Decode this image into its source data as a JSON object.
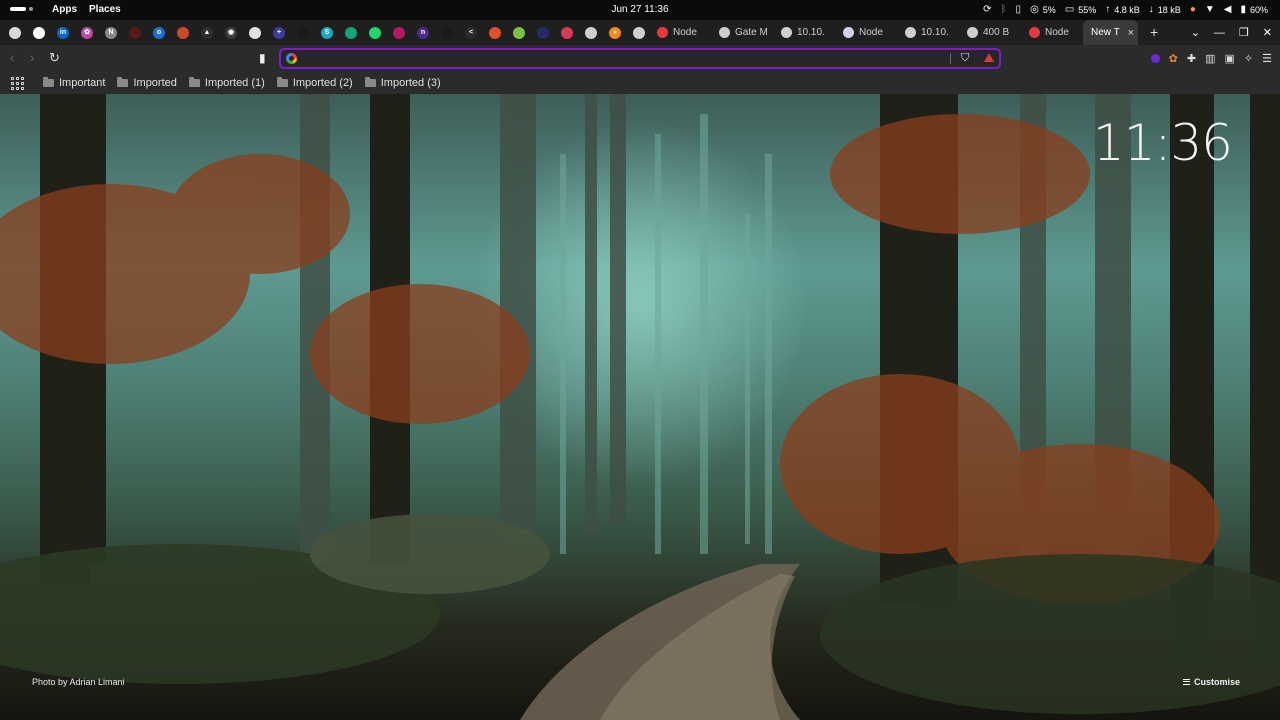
{
  "topbar": {
    "apps_label": "Apps",
    "places_label": "Places",
    "datetime": "Jun 27  11:36",
    "tray": {
      "cpu": "5%",
      "memory": "55%",
      "upload": "4.8 kB",
      "download": "18 kB",
      "battery": "60%"
    }
  },
  "pinned_tabs": [
    {
      "icon": "chrome-icon",
      "color": "#d8d8d8",
      "glyph": ""
    },
    {
      "icon": "github-icon",
      "color": "#ffffff",
      "glyph": ""
    },
    {
      "icon": "linkedin-icon",
      "color": "#0a66c2",
      "glyph": "in"
    },
    {
      "icon": "app-icon",
      "color": "#b84aa8",
      "glyph": "✿"
    },
    {
      "icon": "app-icon",
      "color": "#888888",
      "glyph": "N"
    },
    {
      "icon": "app-icon",
      "color": "#5a1818",
      "glyph": ""
    },
    {
      "icon": "outlook-icon",
      "color": "#1e6fd0",
      "glyph": "o"
    },
    {
      "icon": "app-icon",
      "color": "#c74a2a",
      "glyph": ""
    },
    {
      "icon": "app-icon",
      "color": "#2f2f2f",
      "glyph": "▲"
    },
    {
      "icon": "app-icon",
      "color": "#3c3c3c",
      "glyph": "◉"
    },
    {
      "icon": "app-icon",
      "color": "#e0e0e0",
      "glyph": ""
    },
    {
      "icon": "app-icon",
      "color": "#3b3f9a",
      "glyph": "+"
    },
    {
      "icon": "app-icon",
      "color": "#1a1a1a",
      "glyph": ""
    },
    {
      "icon": "app-icon",
      "color": "#1aa7c4",
      "glyph": "S"
    },
    {
      "icon": "app-icon",
      "color": "#12a37a",
      "glyph": ""
    },
    {
      "icon": "whatsapp-icon",
      "color": "#25d366",
      "glyph": ""
    },
    {
      "icon": "app-icon",
      "color": "#b01b63",
      "glyph": ""
    },
    {
      "icon": "app-icon",
      "color": "#4b2a8a",
      "glyph": "n"
    },
    {
      "icon": "app-icon",
      "color": "#1a1a1a",
      "glyph": ""
    },
    {
      "icon": "share-icon",
      "color": "#2c2c2c",
      "glyph": "<"
    },
    {
      "icon": "app-icon",
      "color": "#e0502a",
      "glyph": ""
    },
    {
      "icon": "app-icon",
      "color": "#7bc043",
      "glyph": ""
    },
    {
      "icon": "app-icon",
      "color": "#252a6a",
      "glyph": ""
    },
    {
      "icon": "app-icon",
      "color": "#d63a5a",
      "glyph": ""
    },
    {
      "icon": "app-icon",
      "color": "#cfcfcf",
      "glyph": ""
    },
    {
      "icon": "app-icon",
      "color": "#f08a1a",
      "glyph": "»"
    },
    {
      "icon": "app-icon",
      "color": "#cfcfcf",
      "glyph": ""
    }
  ],
  "tabs": [
    {
      "title": "Node",
      "icon": "node-red-icon",
      "icon_color": "#e33a3a"
    },
    {
      "title": "Gate M",
      "icon": "globe-icon",
      "icon_color": "#cfcfcf"
    },
    {
      "title": "10.10.",
      "icon": "globe-icon",
      "icon_color": "#cfcfcf"
    },
    {
      "title": "Node",
      "icon": "node-flag-icon",
      "icon_color": "#d0d0f0"
    },
    {
      "title": "10.10.",
      "icon": "globe-icon",
      "icon_color": "#cfcfcf"
    },
    {
      "title": "400 B",
      "icon": "globe-icon",
      "icon_color": "#cfcfcf"
    },
    {
      "title": "Node",
      "icon": "node-red-icon",
      "icon_color": "#e33a3a"
    }
  ],
  "active_tab": {
    "title": "New T",
    "close": "×"
  },
  "new_tab_symbol": "+",
  "omnibox": {
    "value": "",
    "placeholder": ""
  },
  "bookmarks": [
    "Important",
    "Imported",
    "Imported (1)",
    "Imported (2)",
    "Imported (3)"
  ],
  "ntp": {
    "clock": "11:36",
    "photo_credit": "Photo by Adrian Limani",
    "customise_label": "Customise"
  },
  "colors": {
    "omnibox_border": "#7a1fc8",
    "toolbar_bg": "#2b2b2b",
    "tabstrip_bg": "#1f1f1f"
  }
}
